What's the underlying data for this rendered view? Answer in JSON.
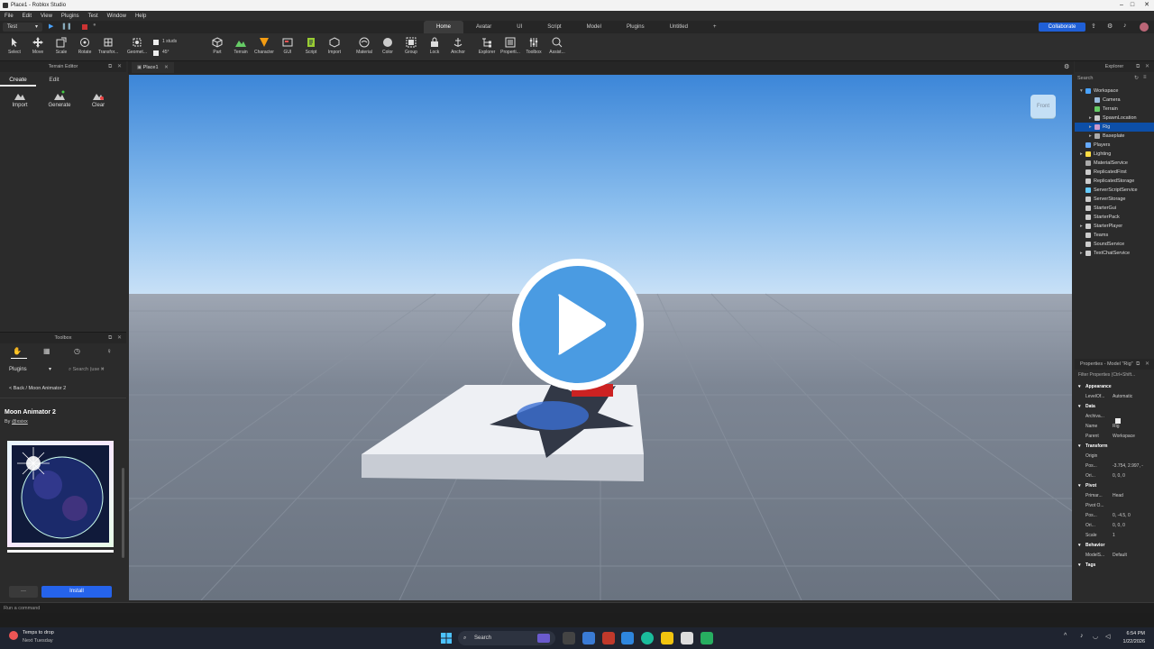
{
  "window": {
    "title": "Place1 - Roblox Studio"
  },
  "menu": [
    "File",
    "Edit",
    "View",
    "Plugins",
    "Test",
    "Window",
    "Help"
  ],
  "tabs": [
    "Home",
    "Avatar",
    "UI",
    "Script",
    "Model",
    "Plugins",
    "Untitled",
    "+"
  ],
  "mode": "Test",
  "collaborate": "Collaborate",
  "ribbon": {
    "tools": [
      "Select",
      "Move",
      "Scale",
      "Rotate",
      "Transfor...",
      "Geomet...",
      "Part",
      "Terrain",
      "Character",
      "GUI",
      "Script",
      "Import",
      "Material",
      "Color",
      "Group",
      "Lock",
      "Anchor",
      "Explorer",
      "Properti...",
      "Toolbox",
      "Assist..."
    ],
    "snap_move": "1 studs",
    "snap_rotate": "45°"
  },
  "terrain_editor": {
    "title": "Terrain Editor",
    "tabs": [
      "Create",
      "Edit"
    ],
    "tools": [
      "Import",
      "Generate",
      "Clear"
    ]
  },
  "toolbox": {
    "title": "Toolbox",
    "category": "Plugins",
    "search_placeholder": "Search (use ⌘",
    "breadcrumb": "< Back / Moon Animator 2",
    "item_name": "Moon Animator 2",
    "by_prefix": "By",
    "author": "@xsixx",
    "more_button": "···",
    "install_button": "Install"
  },
  "document": {
    "tab": "Place1"
  },
  "viewport": {
    "front_label": "Front"
  },
  "explorer": {
    "title": "Explorer",
    "search_placeholder": "Search",
    "items": [
      {
        "label": "Workspace",
        "color": "#4aa3ff"
      },
      {
        "label": "Camera",
        "color": "#9bd"
      },
      {
        "label": "Terrain",
        "color": "#6c6"
      },
      {
        "label": "SpawnLocation",
        "color": "#ccc"
      },
      {
        "label": "Rig",
        "color": "#c9c"
      },
      {
        "label": "Baseplate",
        "color": "#aaa"
      },
      {
        "label": "Players",
        "color": "#6af"
      },
      {
        "label": "Lighting",
        "color": "#fd4"
      },
      {
        "label": "MaterialService",
        "color": "#aaa"
      },
      {
        "label": "ReplicatedFirst",
        "color": "#ccc"
      },
      {
        "label": "ReplicatedStorage",
        "color": "#ccc"
      },
      {
        "label": "ServerScriptService",
        "color": "#6cf"
      },
      {
        "label": "ServerStorage",
        "color": "#ccc"
      },
      {
        "label": "StarterGui",
        "color": "#ccc"
      },
      {
        "label": "StarterPack",
        "color": "#ccc"
      },
      {
        "label": "StarterPlayer",
        "color": "#ccc"
      },
      {
        "label": "Teams",
        "color": "#ccc"
      },
      {
        "label": "SoundService",
        "color": "#ccc"
      },
      {
        "label": "TextChatService",
        "color": "#ccc"
      }
    ]
  },
  "properties": {
    "title": "Properties - Model \"Rig\"",
    "filter": "Filter Properties (Ctrl+Shift...",
    "rows": [
      {
        "k": "Appearance",
        "v": "",
        "sec": true
      },
      {
        "k": "LevelOf...",
        "v": "Automatic"
      },
      {
        "k": "Data",
        "v": "",
        "sec": true
      },
      {
        "k": "Archiva...",
        "v": ""
      },
      {
        "k": "Name",
        "v": "Rig"
      },
      {
        "k": "Parent",
        "v": "Workspace"
      },
      {
        "k": "Transform",
        "v": "",
        "sec": true
      },
      {
        "k": "Origin",
        "v": ""
      },
      {
        "k": "Pos...",
        "v": "-3.754, 2.997, -"
      },
      {
        "k": "Ori...",
        "v": "0, 0, 0"
      },
      {
        "k": "Pivot",
        "v": "",
        "sec": true
      },
      {
        "k": "Primar...",
        "v": "Head"
      },
      {
        "k": "Pivot O...",
        "v": ""
      },
      {
        "k": "Pos...",
        "v": "0, -4.5, 0"
      },
      {
        "k": "Ori...",
        "v": "0, 0, 0"
      },
      {
        "k": "Scale",
        "v": "1"
      },
      {
        "k": "Behavior",
        "v": "",
        "sec": true
      },
      {
        "k": "ModelS...",
        "v": "Default"
      },
      {
        "k": "Tags",
        "v": "",
        "sec": true
      }
    ]
  },
  "command_bar": {
    "placeholder": "Run a command"
  },
  "taskbar": {
    "weather_line1": "Temps to drop",
    "weather_line2": "Next Tuesday",
    "search": "Search",
    "time": "6:54 PM",
    "date": "1/22/2026"
  }
}
